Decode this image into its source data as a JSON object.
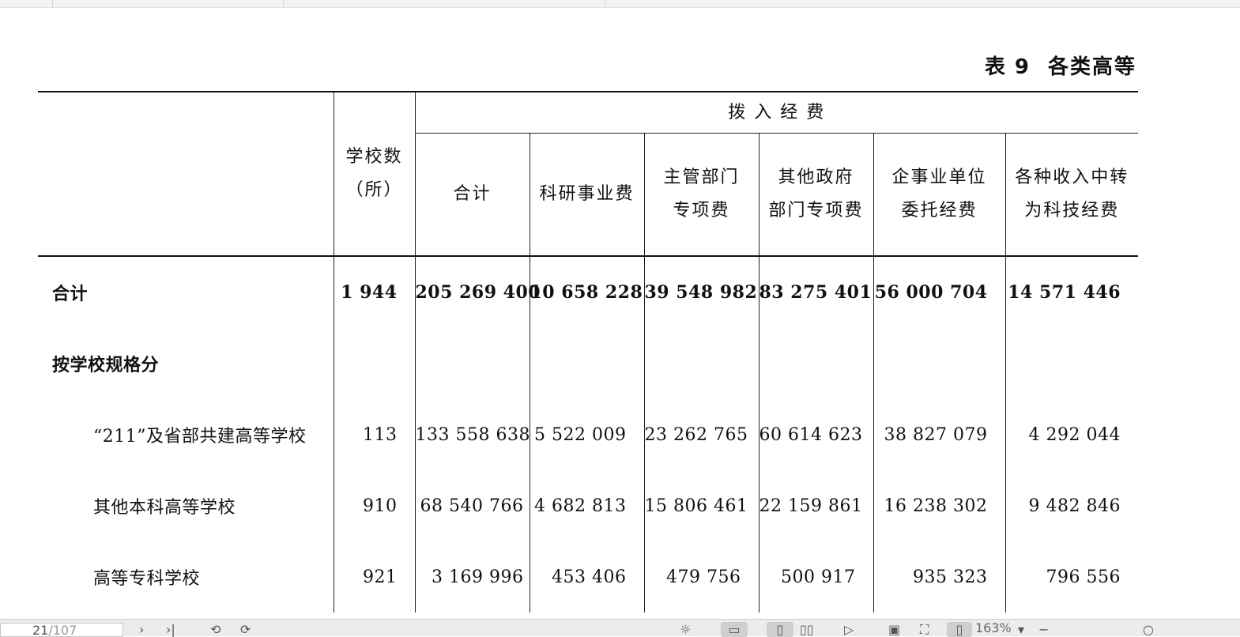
{
  "document": {
    "title_prefix": "表",
    "title_number": "9",
    "title_text": "各类高等"
  },
  "table": {
    "header": {
      "school_count_line1": "学校数",
      "school_count_line2": "（所）",
      "group_label": "拨 入 经 费",
      "columns": [
        {
          "line1": "合计",
          "line2": ""
        },
        {
          "line1": "科研事业费",
          "line2": ""
        },
        {
          "line1": "主管部门",
          "line2": "专项费"
        },
        {
          "line1": "其他政府",
          "line2": "部门专项费"
        },
        {
          "line1": "企事业单位",
          "line2": "委托经费"
        },
        {
          "line1": "各种收入中转",
          "line2": "为科技经费"
        }
      ]
    },
    "rows": [
      {
        "label": "合计",
        "schools": "1 944",
        "values": [
          "205 269 400",
          "10 658 228",
          "39 548 982",
          "83 275 401",
          "56 000 704",
          "14 571 446"
        ]
      },
      {
        "label": "按学校规格分",
        "schools": "",
        "values": [
          "",
          "",
          "",
          "",
          "",
          ""
        ]
      },
      {
        "label": "“211”及省部共建高等学校",
        "schools": "113",
        "values": [
          "133 558 638",
          "5 522 009",
          "23 262 765",
          "60 614 623",
          "38 827 079",
          "4 292 044"
        ]
      },
      {
        "label": "其他本科高等学校",
        "schools": "910",
        "values": [
          "68 540 766",
          "4 682 813",
          "15 806 461",
          "22 159 861",
          "16 238 302",
          "9 482 846"
        ]
      },
      {
        "label": "高等专科学校",
        "schools": "921",
        "values": [
          "3 169 996",
          "453 406",
          "479 756",
          "500 917",
          "935 323",
          "796 556"
        ]
      }
    ]
  },
  "status_bar": {
    "current_page": "21",
    "total_pages": "/107",
    "zoom": "163%"
  }
}
